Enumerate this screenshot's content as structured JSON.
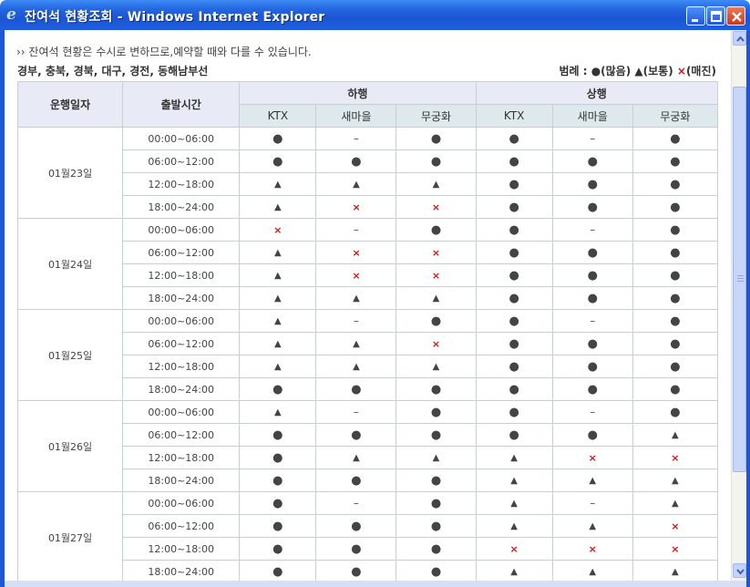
{
  "window": {
    "title": "잔여석 현황조회 - Windows Internet Explorer",
    "controls": {
      "minimize": "minimize",
      "maximize": "maximize",
      "close": "close"
    }
  },
  "notice": "›› 잔여석 현황은 수시로 변하므로,예약할 때와 다를 수 있습니다.",
  "routes": "경부, 충북, 경북, 대구, 경전, 동해남부선",
  "legend": {
    "label": "범례 :",
    "many": "●(많음)",
    "normal": "▲(보통)",
    "soldout_symbol": "×",
    "soldout_text": "(매진)"
  },
  "table": {
    "headers": {
      "date": "운행일자",
      "time": "출발시간",
      "down": "하행",
      "up": "상행",
      "types": [
        "KTX",
        "새마을",
        "무궁화",
        "KTX",
        "새마을",
        "무궁화"
      ]
    },
    "symbols": {
      "c": "●",
      "t": "▲",
      "x": "×",
      "d": "–"
    },
    "days": [
      {
        "date": "01월23일",
        "rows": [
          {
            "time": "00:00~06:00",
            "cells": [
              "c",
              "d",
              "c",
              "c",
              "d",
              "c"
            ]
          },
          {
            "time": "06:00~12:00",
            "cells": [
              "c",
              "c",
              "c",
              "c",
              "c",
              "c"
            ]
          },
          {
            "time": "12:00~18:00",
            "cells": [
              "t",
              "t",
              "t",
              "c",
              "c",
              "c"
            ]
          },
          {
            "time": "18:00~24:00",
            "cells": [
              "t",
              "x",
              "x",
              "c",
              "c",
              "c"
            ]
          }
        ]
      },
      {
        "date": "01월24일",
        "rows": [
          {
            "time": "00:00~06:00",
            "cells": [
              "x",
              "d",
              "c",
              "c",
              "d",
              "c"
            ]
          },
          {
            "time": "06:00~12:00",
            "cells": [
              "t",
              "x",
              "x",
              "c",
              "c",
              "c"
            ]
          },
          {
            "time": "12:00~18:00",
            "cells": [
              "t",
              "x",
              "x",
              "c",
              "c",
              "c"
            ]
          },
          {
            "time": "18:00~24:00",
            "cells": [
              "t",
              "t",
              "t",
              "c",
              "c",
              "c"
            ]
          }
        ]
      },
      {
        "date": "01월25일",
        "rows": [
          {
            "time": "00:00~06:00",
            "cells": [
              "t",
              "d",
              "c",
              "c",
              "d",
              "c"
            ]
          },
          {
            "time": "06:00~12:00",
            "cells": [
              "t",
              "t",
              "x",
              "c",
              "c",
              "c"
            ]
          },
          {
            "time": "12:00~18:00",
            "cells": [
              "t",
              "t",
              "t",
              "c",
              "c",
              "c"
            ]
          },
          {
            "time": "18:00~24:00",
            "cells": [
              "c",
              "c",
              "c",
              "c",
              "c",
              "c"
            ]
          }
        ]
      },
      {
        "date": "01월26일",
        "rows": [
          {
            "time": "00:00~06:00",
            "cells": [
              "t",
              "d",
              "c",
              "c",
              "d",
              "c"
            ]
          },
          {
            "time": "06:00~12:00",
            "cells": [
              "c",
              "c",
              "c",
              "c",
              "c",
              "t"
            ]
          },
          {
            "time": "12:00~18:00",
            "cells": [
              "c",
              "t",
              "t",
              "t",
              "x",
              "x"
            ]
          },
          {
            "time": "18:00~24:00",
            "cells": [
              "c",
              "c",
              "c",
              "t",
              "t",
              "t"
            ]
          }
        ]
      },
      {
        "date": "01월27일",
        "rows": [
          {
            "time": "00:00~06:00",
            "cells": [
              "c",
              "d",
              "c",
              "t",
              "d",
              "t"
            ]
          },
          {
            "time": "06:00~12:00",
            "cells": [
              "c",
              "c",
              "c",
              "t",
              "t",
              "x"
            ]
          },
          {
            "time": "12:00~18:00",
            "cells": [
              "c",
              "c",
              "c",
              "x",
              "x",
              "x"
            ]
          },
          {
            "time": "18:00~24:00",
            "cells": [
              "c",
              "c",
              "c",
              "t",
              "t",
              "t"
            ]
          }
        ]
      }
    ]
  }
}
